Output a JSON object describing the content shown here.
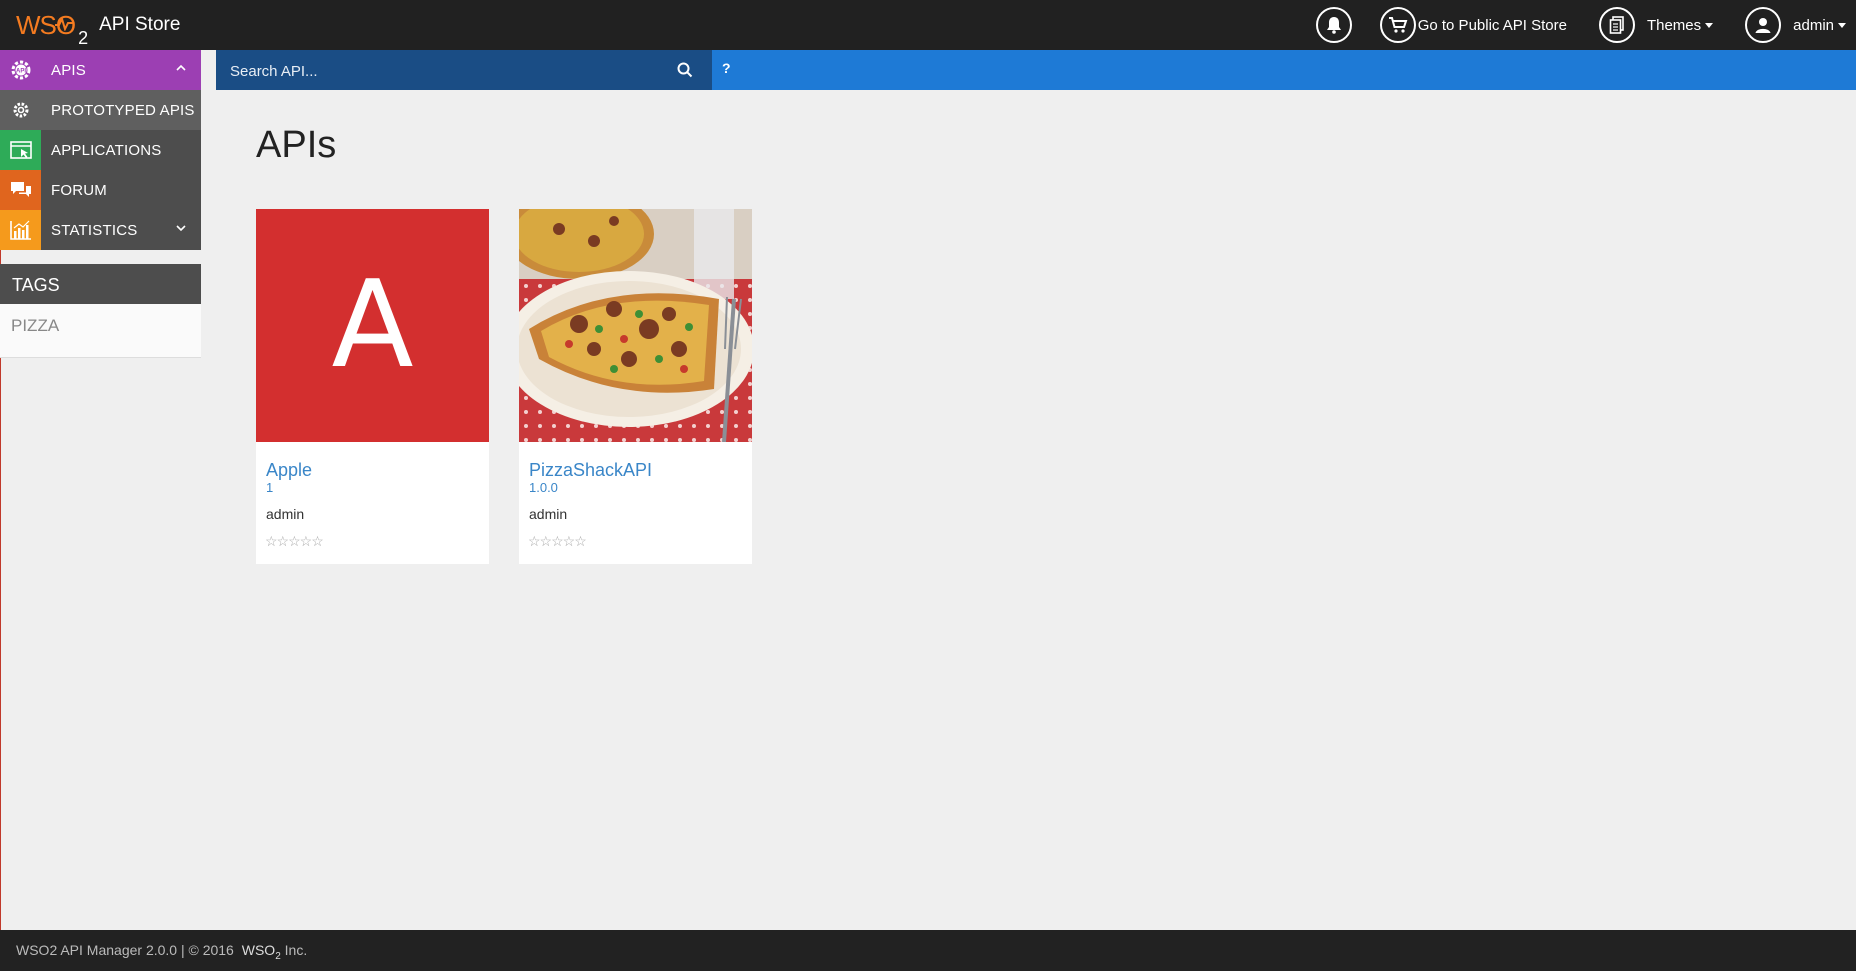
{
  "header": {
    "logo_text": "WSO",
    "logo_sub": "2",
    "app_name": "API Store",
    "public_store_label": "Go to Public API Store",
    "themes_label": "Themes",
    "user_label": "admin"
  },
  "sidebar": {
    "items": [
      {
        "label": "APIs",
        "icon": "api-gear-icon",
        "color": "#9c3fb3"
      },
      {
        "label": "Prototyped APIs",
        "icon": "gear-icon",
        "color": "#4d4d4d"
      },
      {
        "label": "Applications",
        "icon": "application-window-icon",
        "color": "#2eab58"
      },
      {
        "label": "Forum",
        "icon": "chat-bubbles-icon",
        "color": "#e0651e"
      },
      {
        "label": "Statistics",
        "icon": "bar-chart-icon",
        "color": "#f59a1c"
      }
    ],
    "tags_title": "TAGS",
    "tags": [
      "PIZZA"
    ]
  },
  "search": {
    "placeholder": "Search API...",
    "help_label": "?"
  },
  "main": {
    "title": "APIs",
    "cards": [
      {
        "thumb_letter": "A",
        "thumb_color": "#d32f2f",
        "name": "Apple",
        "version": "1",
        "owner": "admin",
        "rating": 0,
        "stars": "☆☆☆☆☆"
      },
      {
        "thumb_image": "pizza-photo",
        "name": "PizzaShackAPI",
        "version": "1.0.0",
        "owner": "admin",
        "rating": 0,
        "stars": "☆☆☆☆☆"
      }
    ]
  },
  "footer": {
    "text_before": "WSO2 API Manager 2.0.0 | © 2016",
    "logo_text": "WSO",
    "logo_sub": "2",
    "text_after": "Inc."
  },
  "colors": {
    "header_bg": "#212121",
    "search_bar_bg": "#1e7ad6",
    "search_box_bg": "#1a4d85",
    "link": "#3a86c8",
    "apis_purple": "#9c3fb3",
    "applications_green": "#2eab58",
    "forum_orange": "#e0651e",
    "statistics_amber": "#f59a1c"
  }
}
